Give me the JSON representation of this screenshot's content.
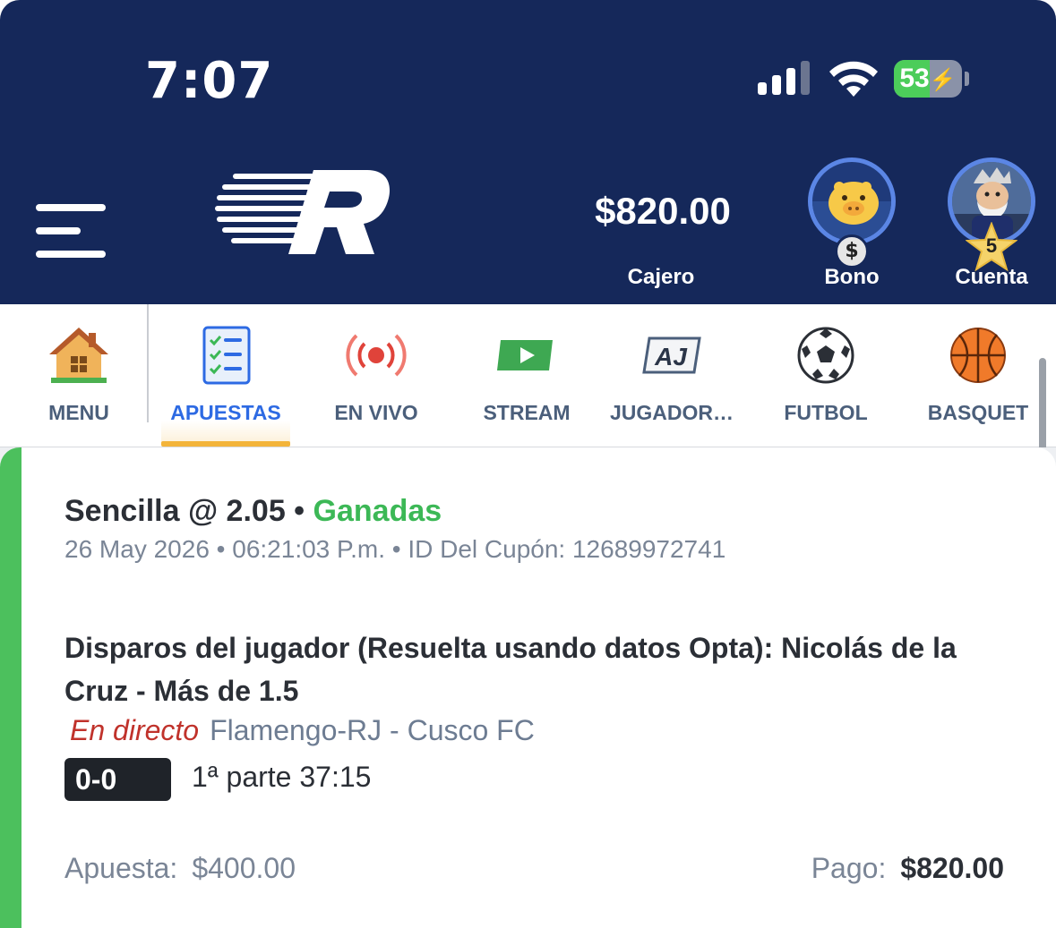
{
  "status_bar": {
    "time": "7:07",
    "battery_percent": "53",
    "battery_level": 0.53,
    "signal_bars_active": 3
  },
  "header": {
    "balance": "$820.00",
    "cashier_label": "Cajero",
    "bonus_label": "Bono",
    "bonus_coin": "$",
    "account_label": "Cuenta",
    "account_level": "5",
    "colors": {
      "background": "#15285a",
      "avatar_ring": "#5b86e5"
    }
  },
  "nav": {
    "active": "APUESTAS",
    "items": [
      {
        "label": "MENU",
        "icon": "house-icon"
      },
      {
        "label": "APUESTAS",
        "icon": "checklist-icon"
      },
      {
        "label": "EN VIVO",
        "icon": "live-broadcast-icon"
      },
      {
        "label": "STREAM",
        "icon": "play-video-icon"
      },
      {
        "label": "JUGADOR…",
        "icon": "player-aj-icon"
      },
      {
        "label": "FUTBOL",
        "icon": "soccer-ball-icon"
      },
      {
        "label": "BASQUET",
        "icon": "basketball-icon"
      }
    ]
  },
  "bet": {
    "type": "Sencilla @ 2.05",
    "separator": " • ",
    "status": "Ganadas",
    "meta": "26 May 2026 • 06:21:03 P.m. • ID Del Cupón: 12689972741",
    "market": "Disparos del jugador (Resuelta usando datos Opta): Nicolás de la Cruz - Más de 1.5",
    "live_label": "En directo",
    "event": "Flamengo-RJ - Cusco FC",
    "score": "0-0",
    "period": "1ª parte 37:15",
    "stake_label": "Apuesta:",
    "stake": "$400.00",
    "payout_label": "Pago:",
    "payout": "$820.00",
    "colors": {
      "won": "#3cb856",
      "card_accent": "#4cc05d",
      "live": "#c0322b",
      "active_tab": "#2d6ae3",
      "tab_underline": "#f3b43a"
    }
  }
}
